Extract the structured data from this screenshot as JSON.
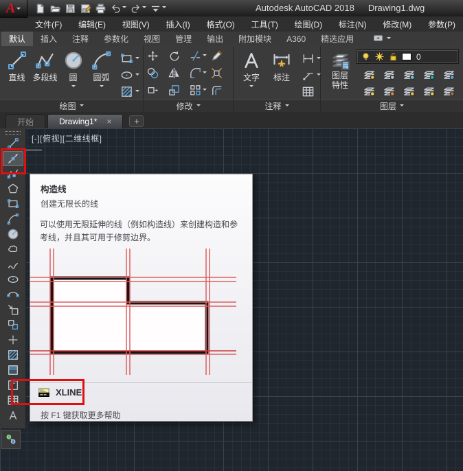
{
  "app": {
    "logo_letter": "A",
    "title_product": "Autodesk AutoCAD 2018",
    "title_file": "Drawing1.dwg"
  },
  "quick_access": {
    "buttons": [
      {
        "name": "new-file"
      },
      {
        "name": "open-file"
      },
      {
        "name": "save"
      },
      {
        "name": "save-as"
      },
      {
        "name": "plot"
      },
      {
        "name": "undo",
        "dropdown": true
      },
      {
        "name": "redo",
        "dropdown": true
      },
      {
        "name": "customize",
        "dropdown": true
      }
    ]
  },
  "menu_bar": {
    "items": [
      "文件(F)",
      "编辑(E)",
      "视图(V)",
      "插入(I)",
      "格式(O)",
      "工具(T)",
      "绘图(D)",
      "标注(N)",
      "修改(M)",
      "参数(P)"
    ]
  },
  "ribbon": {
    "tabs": [
      {
        "label": "默认",
        "active": true
      },
      {
        "label": "插入"
      },
      {
        "label": "注释"
      },
      {
        "label": "参数化"
      },
      {
        "label": "视图"
      },
      {
        "label": "管理"
      },
      {
        "label": "输出"
      },
      {
        "label": "附加模块"
      },
      {
        "label": "A360"
      },
      {
        "label": "精选应用"
      }
    ],
    "draw_panel": {
      "label": "绘图",
      "big_buttons": [
        {
          "label": "直线",
          "icon": "line"
        },
        {
          "label": "多段线",
          "icon": "polyline"
        },
        {
          "label": "圆",
          "icon": "circle",
          "dropdown": true
        },
        {
          "label": "圆弧",
          "icon": "arc",
          "dropdown": true
        }
      ],
      "side_buttons": [
        {
          "icon": "rectangle",
          "dropdown": true
        },
        {
          "icon": "ellipse",
          "dropdown": true
        },
        {
          "icon": "hatch",
          "dropdown": true
        }
      ]
    },
    "modify_panel": {
      "label": "修改",
      "buttons": [
        {
          "icon": "move"
        },
        {
          "icon": "rotate"
        },
        {
          "icon": "trim",
          "dropdown": true
        },
        {
          "icon": "erase"
        },
        {
          "icon": "copy"
        },
        {
          "icon": "mirror"
        },
        {
          "icon": "fillet",
          "dropdown": true
        },
        {
          "icon": "explode"
        },
        {
          "icon": "stretch"
        },
        {
          "icon": "scale"
        },
        {
          "icon": "array",
          "dropdown": true
        },
        {
          "icon": "offset"
        }
      ]
    },
    "annotation_panel": {
      "label": "注释",
      "big_buttons": [
        {
          "label": "文字",
          "icon": "text",
          "dropdown": true
        },
        {
          "label": "标注",
          "icon": "dimension"
        }
      ],
      "side_buttons": [
        {
          "icon": "dim-linear",
          "dropdown": true
        },
        {
          "icon": "leader",
          "dropdown": true
        },
        {
          "icon": "table"
        }
      ]
    },
    "layers_panel": {
      "label": "图层",
      "properties_label_line1": "图层",
      "properties_label_line2": "特性",
      "layer_combo": {
        "value": "0",
        "icons": [
          "bulb",
          "sun",
          "unlock",
          "color-swatch"
        ]
      },
      "tools": [
        "layer-off",
        "layer-isolate",
        "layer-freeze",
        "layer-lock",
        "layer-make-current",
        "layer-on",
        "layer-unisolate",
        "layer-thaw",
        "layer-unlock",
        "layer-match"
      ]
    }
  },
  "file_tabs": {
    "tabs": [
      {
        "label": "开始"
      },
      {
        "label": "Drawing1*",
        "active": true,
        "closable": true
      }
    ],
    "close_glyph": "×",
    "new_tab_glyph": "+"
  },
  "viewport": {
    "label": "[-][俯视][二维线框]"
  },
  "left_toolbar": {
    "icons": [
      "line",
      "construction-line",
      "polyline",
      "polygon",
      "rectangle",
      "arc",
      "circle",
      "revision-cloud",
      "spline",
      "ellipse",
      "ellipse-arc",
      "insert-block",
      "create-block",
      "point",
      "hatch",
      "gradient",
      "region",
      "table",
      "multiline-text"
    ],
    "active_icon": "construction-line"
  },
  "secondary_toolbar": {
    "icons": [
      "point-style"
    ]
  },
  "tooltip": {
    "title": "构造线",
    "subtitle": "创建无限长的线",
    "body": "可以使用无限延伸的线（例如构造线）来创建构造和参考线，并且其可用于修剪边界。",
    "command": "XLINE",
    "command_icon": "command-line",
    "help": "按 F1 键获取更多帮助"
  },
  "colors": {
    "highlight_red": "#dd1111",
    "canvas_bg": "#1f262e",
    "tooltip_bg": "#f4f4f6",
    "construction_line_red": "#dd5f5f",
    "accent_blue": "#5fa8e0"
  }
}
